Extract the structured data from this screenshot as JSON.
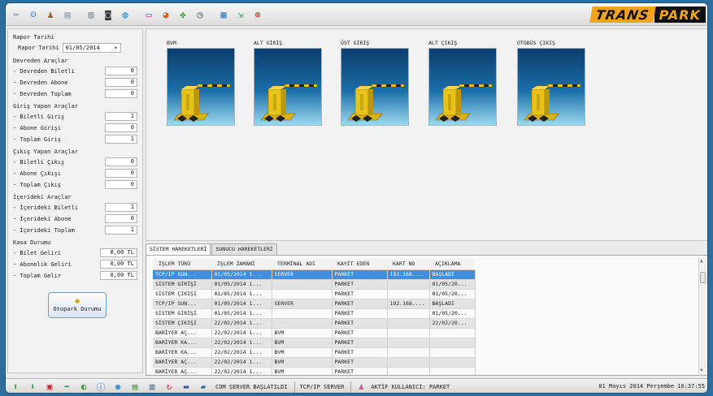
{
  "toolbar": {
    "icons": [
      "tools-icon",
      "users-icon",
      "user-settings-icon",
      "print-preview-icon",
      "printer-icon",
      "camera-icon",
      "globe-icon",
      "flag-icon",
      "pie-chart-icon",
      "plugin-icon",
      "clock-icon",
      "calculator-icon",
      "exit-app-icon",
      "close-circle-icon"
    ],
    "brand_part1": "TRANS",
    "brand_part2": "PARK"
  },
  "left": {
    "report_date_group": "Rapor Tarihi",
    "report_date_label": "Rapor Tarihi",
    "report_date_value": "01/05/2014",
    "devreden": {
      "title": "Devreden Araçlar",
      "rows": [
        {
          "label": "- Devreden Biletli",
          "value": "0"
        },
        {
          "label": "- Devreden Abone",
          "value": "0"
        },
        {
          "label": "- Devreden Toplam",
          "value": "0"
        }
      ]
    },
    "giris": {
      "title": "Giriş Yapan Araçlar",
      "rows": [
        {
          "label": "- Biletli Giriş",
          "value": "1"
        },
        {
          "label": "- Abone Girişi",
          "value": "0"
        },
        {
          "label": "- Toplam Giriş",
          "value": "1"
        }
      ]
    },
    "cikis": {
      "title": "Çıkış Yapan Araçlar",
      "rows": [
        {
          "label": "- Biletli Çıkış",
          "value": "0"
        },
        {
          "label": "- Abone Çıkışı",
          "value": "0"
        },
        {
          "label": "- Toplam Çıkış",
          "value": "0"
        }
      ]
    },
    "iceride": {
      "title": "İçerideki Araçlar",
      "rows": [
        {
          "label": "- İçerideki Biletli",
          "value": "1"
        },
        {
          "label": "- İçerideki Abone",
          "value": "0"
        },
        {
          "label": "- İçerideki Toplam",
          "value": "1"
        }
      ]
    },
    "kasa": {
      "title": "Kasa Durumu",
      "rows": [
        {
          "label": "- Bilet Geliri",
          "value": "0,00 TL"
        },
        {
          "label": "- Abonelik Geliri",
          "value": "0,00 TL"
        },
        {
          "label": "- Toplam Gelir",
          "value": "0,00 TL"
        }
      ]
    },
    "otopark_button": "Otopark Durumu"
  },
  "gates": [
    {
      "name": "BVM"
    },
    {
      "name": "ALT GİRİŞ"
    },
    {
      "name": "ÜST GİRİŞ"
    },
    {
      "name": "ALT ÇIKIŞ"
    },
    {
      "name": "OTOBÜS ÇIKIŞ"
    }
  ],
  "tabs": [
    "SİSTEM HAREKETLERİ",
    "SUNUCU HAREKETLERİ"
  ],
  "table": {
    "columns": [
      "İŞLEM TÜRÜ",
      "İŞLEM ZAMANI",
      "TERMİNAL ADI",
      "KAYIT EDEN",
      "KART NO",
      "AÇIKLAMA"
    ],
    "rows": [
      [
        "TCP/IP SUN...",
        "01/05/2014 1...",
        "SERVER",
        "PARKET",
        "192.168....",
        "BAŞLADI"
      ],
      [
        "SİSTEM GİRİŞİ",
        "01/05/2014 1...",
        "",
        "PARKET",
        "",
        "01/05/20..."
      ],
      [
        "SİSTEM ÇIKIŞI",
        "01/05/2014 1...",
        "",
        "PARKET",
        "",
        "01/05/20..."
      ],
      [
        "TCP/IP SUN...",
        "01/05/2014 1...",
        "SERVER",
        "PARKET",
        "192.168....",
        "BAŞLADI"
      ],
      [
        "SİSTEM GİRİŞİ",
        "01/05/2014 1...",
        "",
        "PARKET",
        "",
        "01/05/20..."
      ],
      [
        "SİSTEM ÇIKIŞI",
        "22/02/2014 1...",
        "",
        "PARKET",
        "",
        "22/02/20..."
      ],
      [
        "BARİYER AÇ...",
        "22/02/2014 1...",
        "BVM",
        "PARKET",
        "",
        ""
      ],
      [
        "BARİYER KA...",
        "22/02/2014 1...",
        "BVM",
        "PARKET",
        "",
        ""
      ],
      [
        "BARİYER KA...",
        "22/02/2014 1...",
        "BVM",
        "PARKET",
        "",
        ""
      ],
      [
        "BARİYER AÇ...",
        "22/02/2014 1...",
        "BVM",
        "PARKET",
        "",
        ""
      ],
      [
        "BARİYER AÇ...",
        "22/02/2014 1...",
        "BVM",
        "PARKET",
        "",
        ""
      ]
    ]
  },
  "status": {
    "com_server": "COM SERVER BAŞLATILDI",
    "tcp_server": "TCP/IP SERVER",
    "active_user": "AKTİF KULLANICI: PARKET",
    "datetime": "01 Mayıs 2014 Perşembe 16:37:55"
  }
}
